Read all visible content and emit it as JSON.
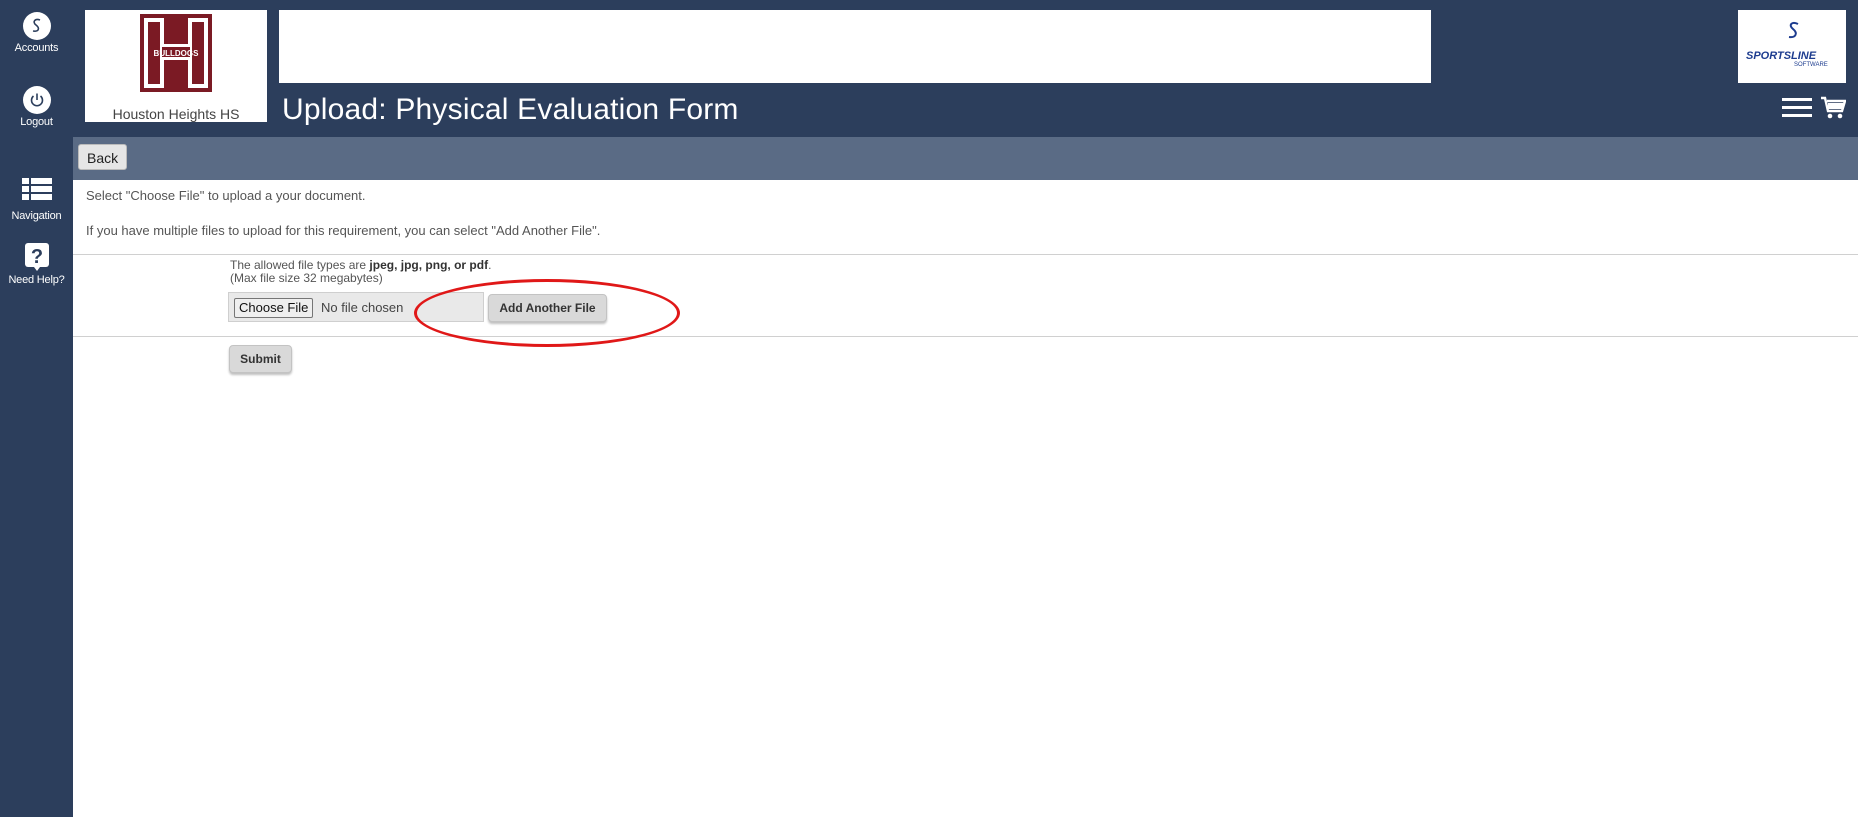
{
  "rail": {
    "accounts_label": "Accounts",
    "logout_label": "Logout",
    "navigation_label": "Navigation",
    "help_label": "Need Help?"
  },
  "header": {
    "school_name": "Houston Heights HS",
    "logo_text": "BULLDOGS",
    "page_title": "Upload: Physical Evaluation Form",
    "vendor_name": "SPORTSLINE",
    "vendor_sub": "SOFTWARE"
  },
  "toolbar": {
    "back_label": "Back"
  },
  "main": {
    "intro_line1": "Select \"Choose File\" to upload a your document.",
    "intro_line2": "If you have multiple files to upload for this requirement, you can select \"Add Another File\".",
    "allowed_prefix": "The allowed file types are",
    "allowed_types": "jpeg, jpg, png, or pdf",
    "allowed_suffix": ".",
    "max_size": "(Max file size 32 megabytes)",
    "choose_label": "Choose File",
    "no_file_text": "No file chosen",
    "add_another_label": "Add Another File",
    "submit_label": "Submit"
  },
  "colors": {
    "navy": "#2c3e5c",
    "toolbar": "#5a6b85",
    "highlight": "#e01818",
    "maroon": "#7b1a24"
  }
}
